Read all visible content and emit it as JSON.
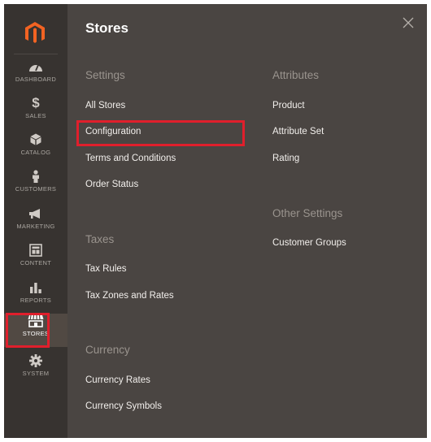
{
  "sidebar": {
    "items": [
      {
        "key": "dashboard",
        "label": "DASHBOARD",
        "icon": "dashboard-gauge-icon"
      },
      {
        "key": "sales",
        "label": "SALES",
        "icon": "dollar-icon"
      },
      {
        "key": "catalog",
        "label": "CATALOG",
        "icon": "cube-icon"
      },
      {
        "key": "customers",
        "label": "CUSTOMERS",
        "icon": "person-icon"
      },
      {
        "key": "marketing",
        "label": "MARKETING",
        "icon": "megaphone-icon"
      },
      {
        "key": "content",
        "label": "CONTENT",
        "icon": "layout-icon"
      },
      {
        "key": "reports",
        "label": "REPORTS",
        "icon": "bar-chart-icon"
      },
      {
        "key": "stores",
        "label": "STORES",
        "icon": "storefront-icon"
      },
      {
        "key": "system",
        "label": "SYSTEM",
        "icon": "gear-icon"
      }
    ],
    "active": "stores"
  },
  "panel": {
    "title": "Stores",
    "settings": {
      "title": "Settings",
      "links": [
        "All Stores",
        "Configuration",
        "Terms and Conditions",
        "Order Status"
      ]
    },
    "taxes": {
      "title": "Taxes",
      "links": [
        "Tax Rules",
        "Tax Zones and Rates"
      ]
    },
    "currency": {
      "title": "Currency",
      "links": [
        "Currency Rates",
        "Currency Symbols"
      ]
    },
    "attributes": {
      "title": "Attributes",
      "links": [
        "Product",
        "Attribute Set",
        "Rating"
      ]
    },
    "other_settings": {
      "title": "Other Settings",
      "links": [
        "Customer Groups"
      ]
    }
  },
  "colors": {
    "highlight": "#e01f2c",
    "brand": "#f26322",
    "sidebar_bg": "#373330",
    "panel_bg": "#4a4542"
  }
}
